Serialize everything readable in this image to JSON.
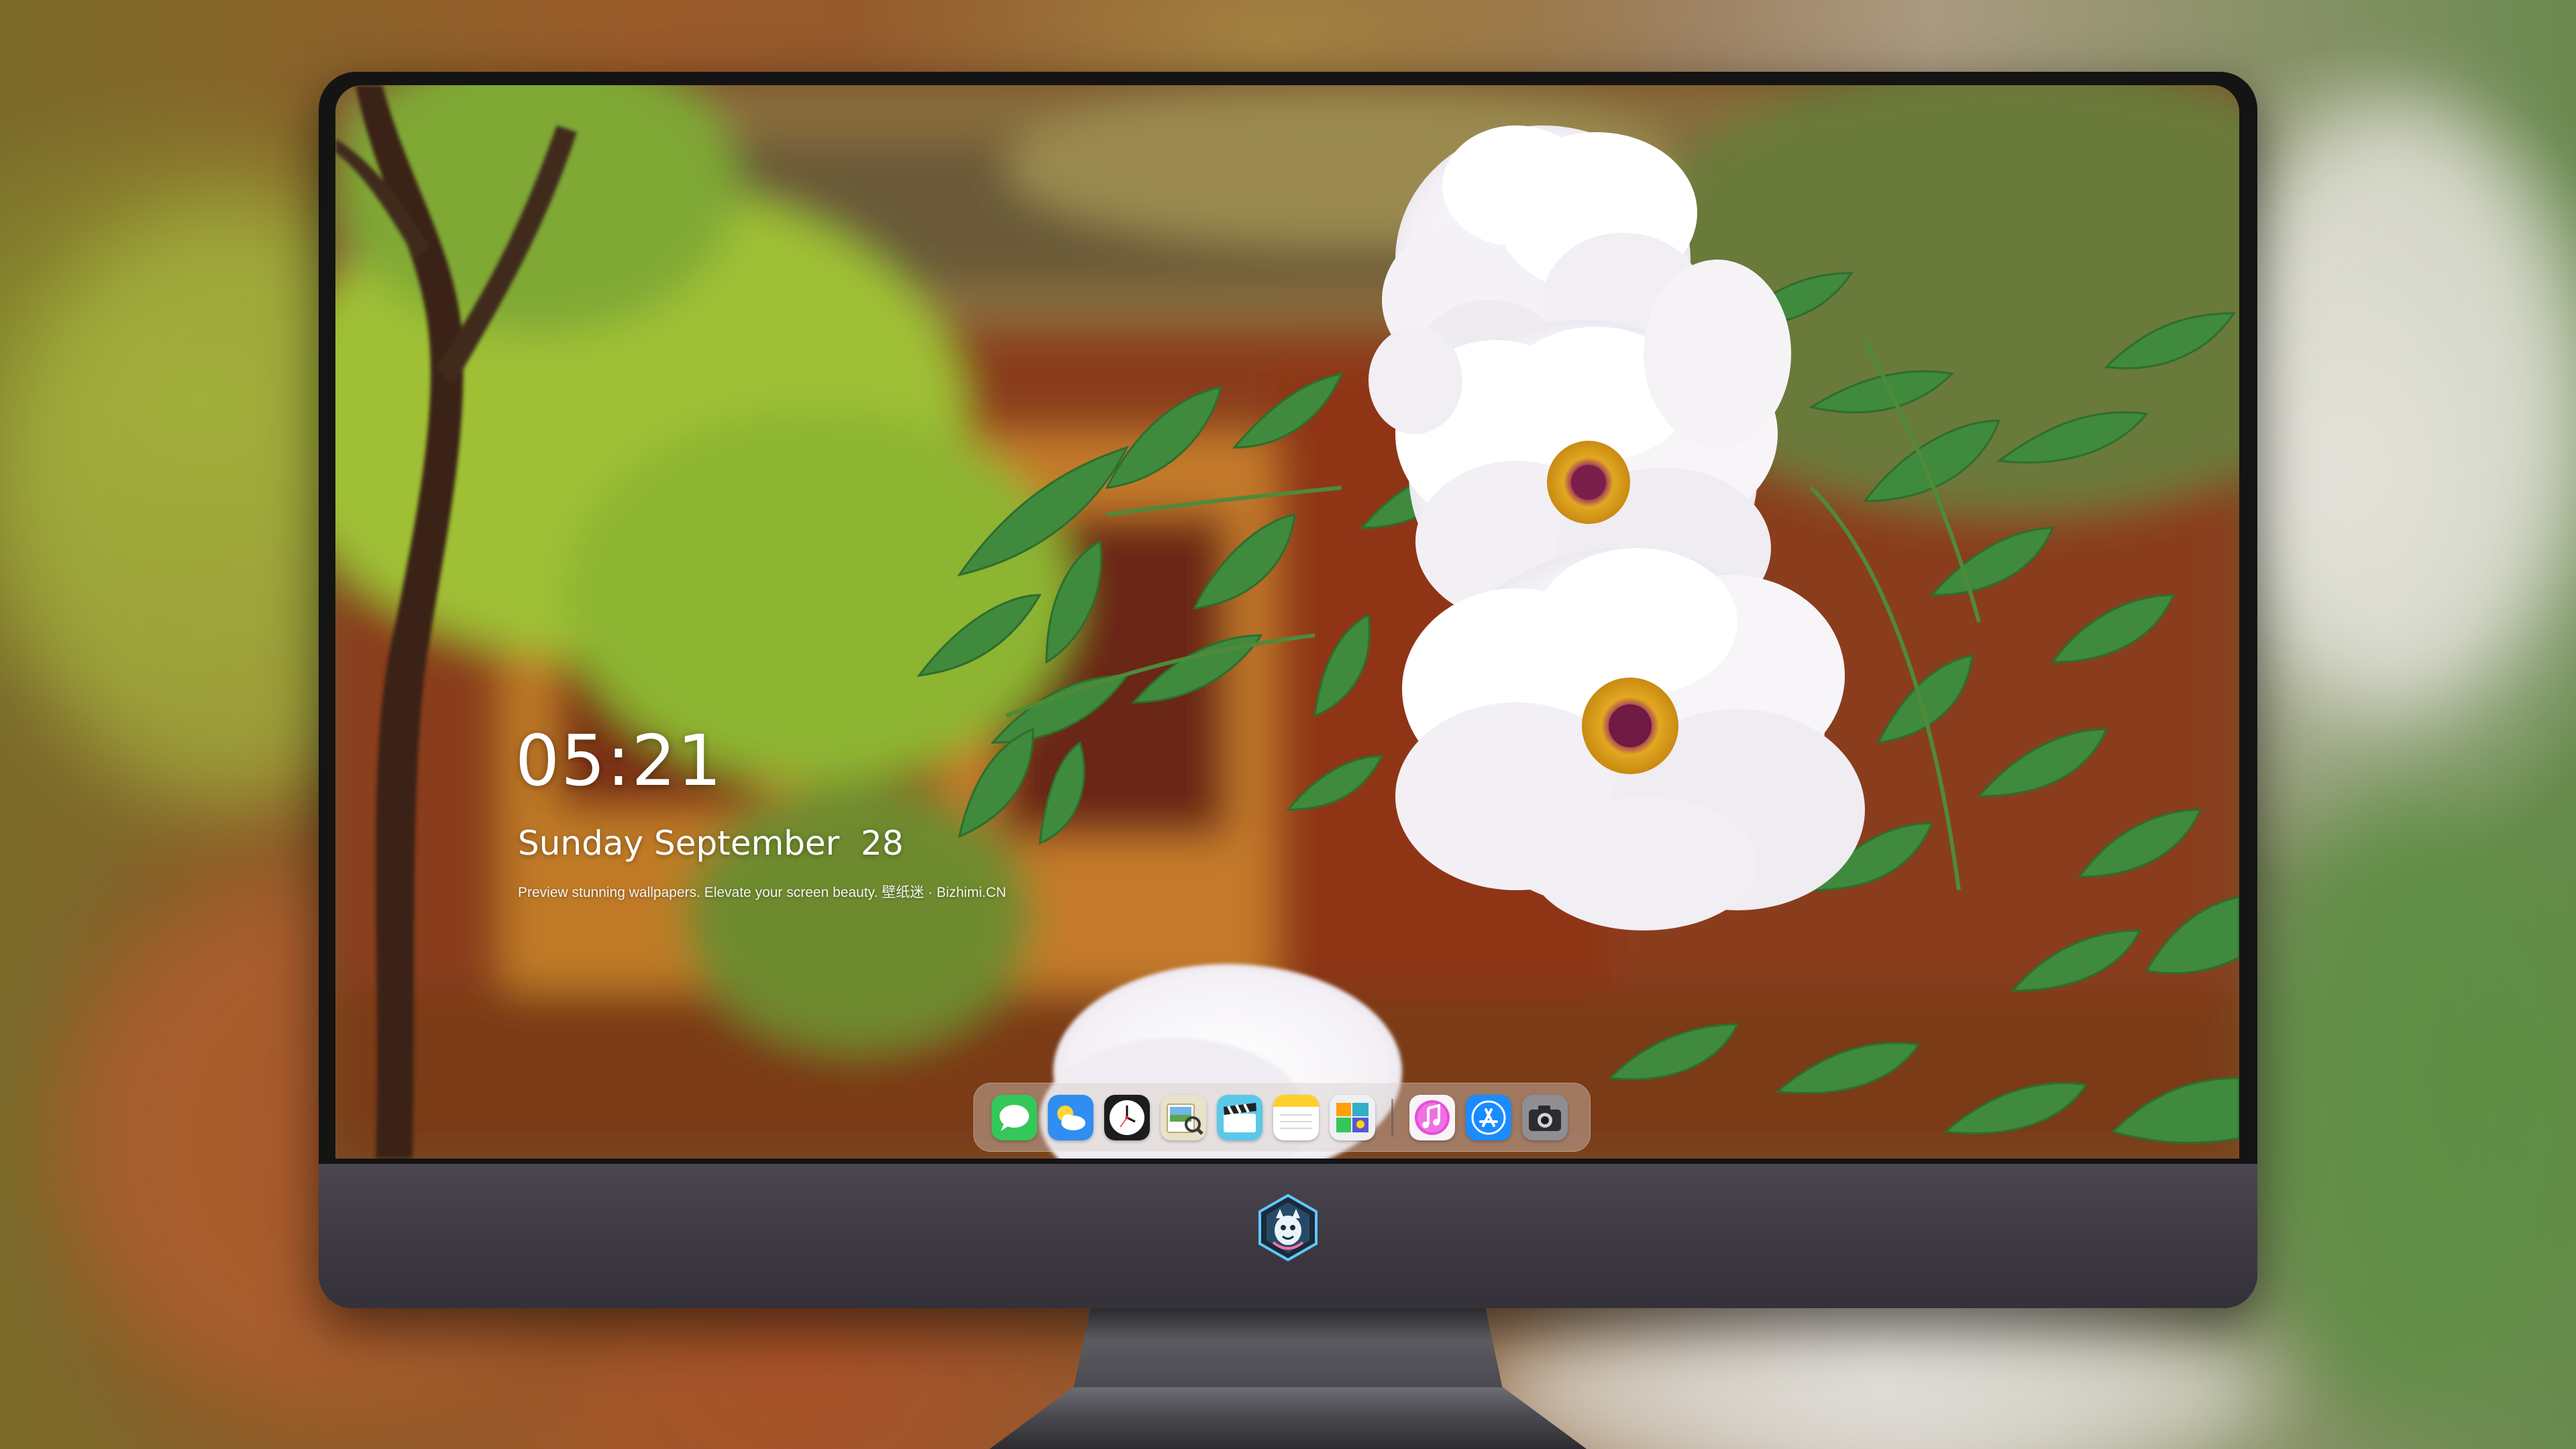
{
  "lock_screen": {
    "time": "05:21",
    "date": "Sunday September  28",
    "tagline": "Preview stunning wallpapers. Elevate your screen beauty. 壁纸迷 · Bizhimi.CN"
  },
  "dock": {
    "apps": [
      {
        "icon": "messages-icon"
      },
      {
        "icon": "weather-icon"
      },
      {
        "icon": "clock-icon"
      },
      {
        "icon": "preview-icon"
      },
      {
        "icon": "claquette-icon"
      },
      {
        "icon": "notes-icon"
      },
      {
        "icon": "photo-editor-icon"
      },
      {
        "icon": "itunes-icon"
      },
      {
        "icon": "app-store-icon"
      },
      {
        "icon": "camera-icon"
      }
    ]
  },
  "monitor": {
    "logo": "dragon-mascot-logo"
  },
  "colors": {
    "monitor_bezel": "#141414",
    "monitor_chin": "#3f3b44",
    "dock_background": "#d7cdc8"
  }
}
